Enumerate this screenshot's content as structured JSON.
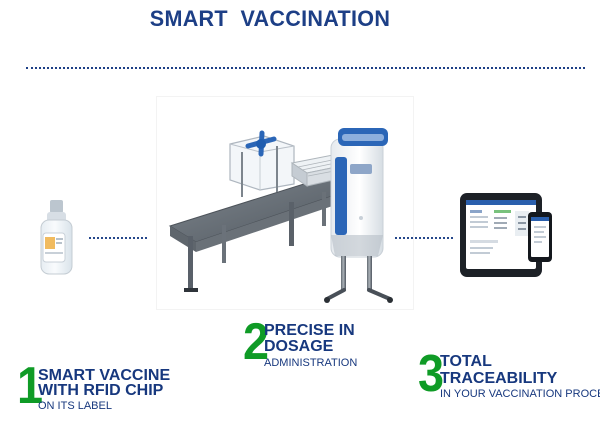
{
  "title": "SMART  VACCINATION",
  "steps": [
    {
      "number": "1",
      "line1": "SMART VACCINE",
      "line2": "WITH RFID CHIP",
      "line3": "ON ITS LABEL"
    },
    {
      "number": "2",
      "line1": "PRECISE IN",
      "line2": "DOSAGE",
      "line3": "ADMINISTRATION"
    },
    {
      "number": "3",
      "line1": "TOTAL",
      "line2": "TRACEABILITY",
      "line3": "IN YOUR VACCINATION PROCESS"
    }
  ],
  "colors": {
    "navy": "#1d3f86",
    "green": "#0f9b26",
    "machine_blue": "#2b66b7",
    "steel": "#6c737b"
  },
  "icons": {
    "vial": "vaccine-vial-icon",
    "machine": "vaccination-machine-icon",
    "devices": "tablet-phone-icon"
  }
}
